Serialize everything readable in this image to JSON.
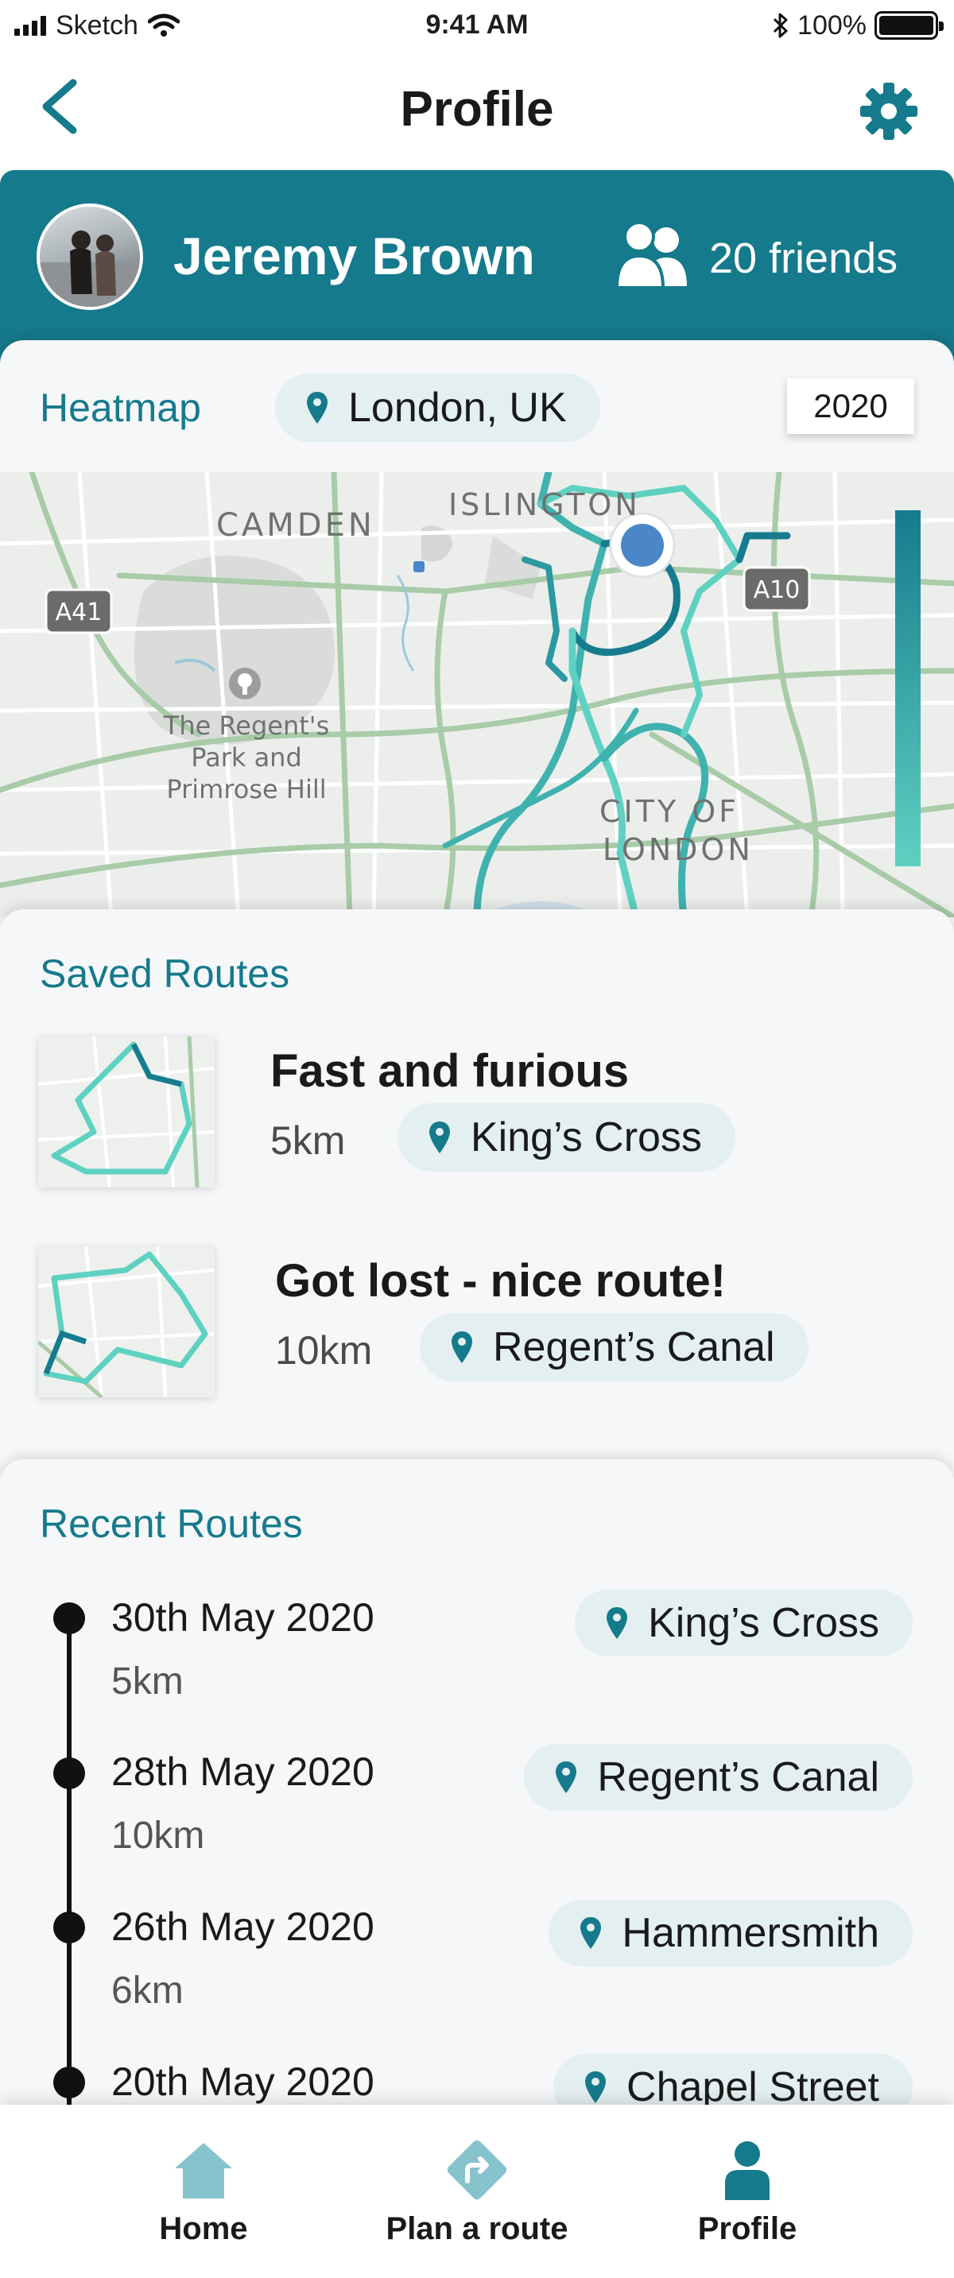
{
  "status_bar": {
    "carrier": "Sketch",
    "time": "9:41 AM",
    "battery": "100%"
  },
  "nav": {
    "title": "Profile"
  },
  "profile": {
    "name": "Jeremy Brown",
    "friends": "20 friends"
  },
  "heatmap": {
    "title": "Heatmap",
    "location": "London, UK",
    "year": "2020",
    "map_labels": {
      "islington": "ISLINGTON",
      "camden": "CAMDEN",
      "park": "The Regent's Park and Primrose Hill",
      "park_line1": "The Regent's",
      "park_line2": "Park and",
      "park_line3": "Primrose Hill",
      "city": "CITY OF LONDON",
      "city_line1": "CITY OF",
      "city_line2": "LONDON",
      "road_a41": "A41",
      "road_a10": "A10"
    }
  },
  "saved_routes": {
    "title": "Saved Routes",
    "items": [
      {
        "name": "Fast and furious",
        "distance": "5km",
        "location": "King’s Cross"
      },
      {
        "name": "Got lost - nice route!",
        "distance": "10km",
        "location": "Regent’s Canal"
      }
    ]
  },
  "recent_routes": {
    "title": "Recent Routes",
    "items": [
      {
        "date": "30th May 2020",
        "distance": "5km",
        "location": "King’s Cross"
      },
      {
        "date": "28th May 2020",
        "distance": "10km",
        "location": "Regent’s Canal"
      },
      {
        "date": "26th May 2020",
        "distance": "6km",
        "location": "Hammersmith"
      },
      {
        "date": "20th May 2020",
        "location": "Chapel Street"
      }
    ]
  },
  "tabs": [
    {
      "label": "Home",
      "icon": "home-icon",
      "active": false
    },
    {
      "label": "Plan a route",
      "icon": "directions-icon",
      "active": false
    },
    {
      "label": "Profile",
      "icon": "person-icon",
      "active": true
    }
  ],
  "colors": {
    "primary": "#157a8c",
    "route_light": "#5ed1c1",
    "chip_bg": "#e4eff1",
    "inactive_icon": "#86c3cd"
  }
}
